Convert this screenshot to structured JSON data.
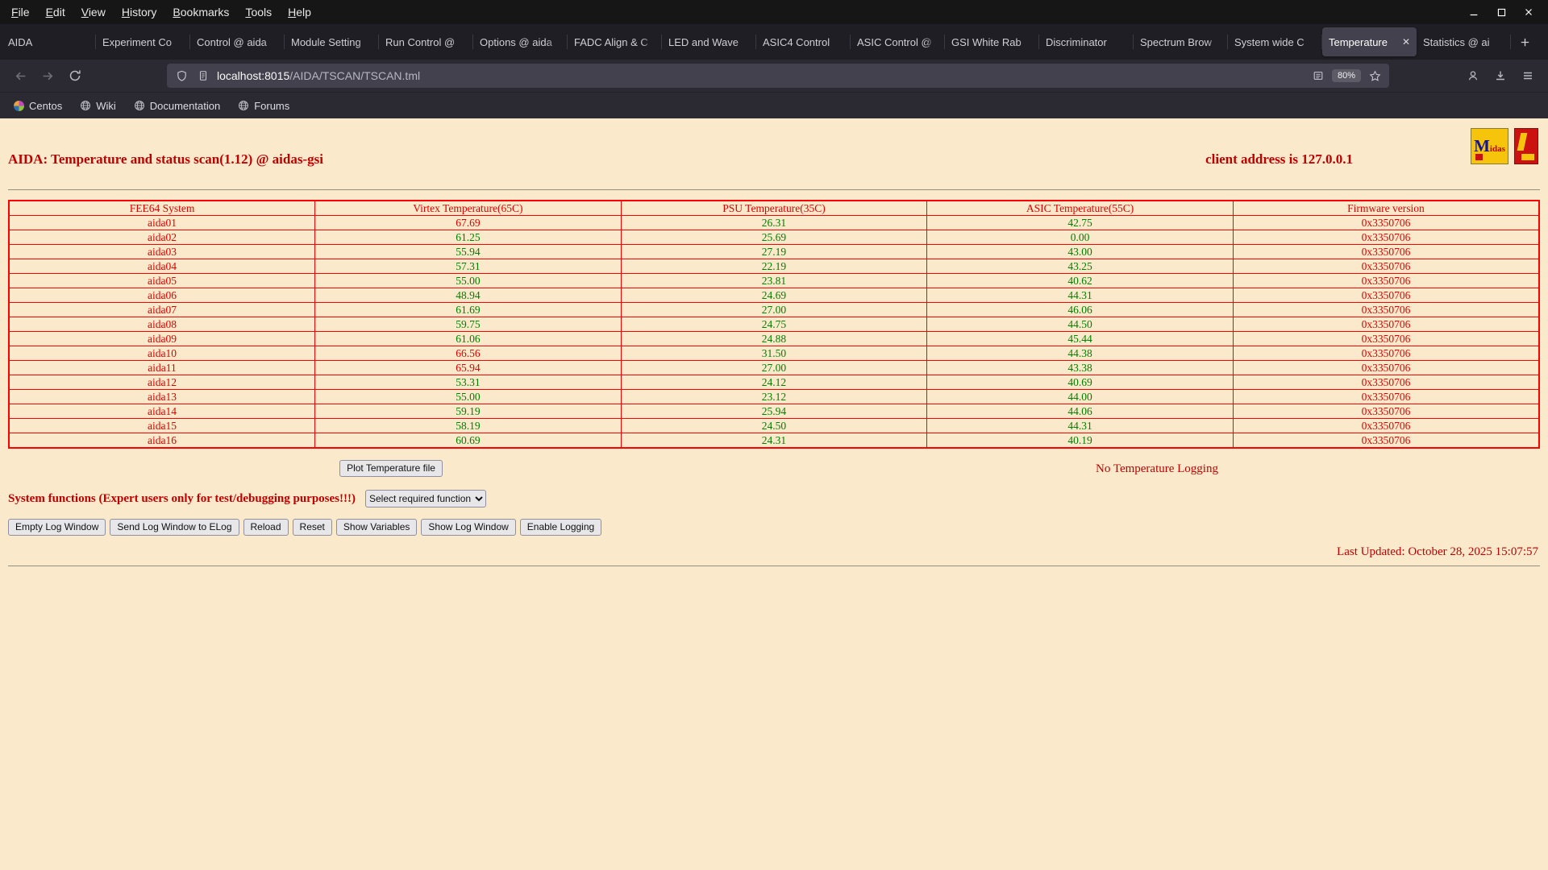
{
  "browser": {
    "menu_items": [
      "File",
      "Edit",
      "View",
      "History",
      "Bookmarks",
      "Tools",
      "Help"
    ],
    "tabs": [
      {
        "label": "AIDA"
      },
      {
        "label": "Experiment Co"
      },
      {
        "label": "Control @ aida"
      },
      {
        "label": "Module Setting"
      },
      {
        "label": "Run Control @"
      },
      {
        "label": "Options @ aida"
      },
      {
        "label": "FADC Align & C"
      },
      {
        "label": "LED and Wave"
      },
      {
        "label": "ASIC4 Control"
      },
      {
        "label": "ASIC Control @"
      },
      {
        "label": "GSI White Rab"
      },
      {
        "label": "Discriminator"
      },
      {
        "label": "Spectrum Brow"
      },
      {
        "label": "System wide C"
      },
      {
        "label": "Temperature",
        "active": true
      },
      {
        "label": "Statistics @ ai"
      }
    ],
    "url_host": "localhost:8015",
    "url_path": "/AIDA/TSCAN/TSCAN.tml",
    "zoom_level": "80%",
    "bookmarks": [
      {
        "label": "Centos",
        "icon": "centos"
      },
      {
        "label": "Wiki",
        "icon": "globe"
      },
      {
        "label": "Documentation",
        "icon": "globe"
      },
      {
        "label": "Forums",
        "icon": "globe"
      }
    ]
  },
  "page": {
    "title": "AIDA: Temperature and status scan(1.12) @ aidas-gsi",
    "client_address": "client address is 127.0.0.1",
    "midas_logo_text": "Midas",
    "table": {
      "headers": [
        "FEE64 System",
        "Virtex Temperature(65C)",
        "PSU Temperature(35C)",
        "ASIC Temperature(55C)",
        "Firmware version"
      ],
      "thresholds": {
        "virtex": 65,
        "psu": 35,
        "asic": 55
      },
      "rows": [
        {
          "name": "aida01",
          "virtex": "67.69",
          "psu": "26.31",
          "asic": "42.75",
          "firmware": "0x3350706"
        },
        {
          "name": "aida02",
          "virtex": "61.25",
          "psu": "25.69",
          "asic": "0.00",
          "firmware": "0x3350706"
        },
        {
          "name": "aida03",
          "virtex": "55.94",
          "psu": "27.19",
          "asic": "43.00",
          "firmware": "0x3350706"
        },
        {
          "name": "aida04",
          "virtex": "57.31",
          "psu": "22.19",
          "asic": "43.25",
          "firmware": "0x3350706"
        },
        {
          "name": "aida05",
          "virtex": "55.00",
          "psu": "23.81",
          "asic": "40.62",
          "firmware": "0x3350706"
        },
        {
          "name": "aida06",
          "virtex": "48.94",
          "psu": "24.69",
          "asic": "44.31",
          "firmware": "0x3350706"
        },
        {
          "name": "aida07",
          "virtex": "61.69",
          "psu": "27.00",
          "asic": "46.06",
          "firmware": "0x3350706"
        },
        {
          "name": "aida08",
          "virtex": "59.75",
          "psu": "24.75",
          "asic": "44.50",
          "firmware": "0x3350706"
        },
        {
          "name": "aida09",
          "virtex": "61.06",
          "psu": "24.88",
          "asic": "45.44",
          "firmware": "0x3350706"
        },
        {
          "name": "aida10",
          "virtex": "66.56",
          "psu": "31.50",
          "asic": "44.38",
          "firmware": "0x3350706"
        },
        {
          "name": "aida11",
          "virtex": "65.94",
          "psu": "27.00",
          "asic": "43.38",
          "firmware": "0x3350706"
        },
        {
          "name": "aida12",
          "virtex": "53.31",
          "psu": "24.12",
          "asic": "40.69",
          "firmware": "0x3350706"
        },
        {
          "name": "aida13",
          "virtex": "55.00",
          "psu": "23.12",
          "asic": "44.00",
          "firmware": "0x3350706"
        },
        {
          "name": "aida14",
          "virtex": "59.19",
          "psu": "25.94",
          "asic": "44.06",
          "firmware": "0x3350706"
        },
        {
          "name": "aida15",
          "virtex": "58.19",
          "psu": "24.50",
          "asic": "44.31",
          "firmware": "0x3350706"
        },
        {
          "name": "aida16",
          "virtex": "60.69",
          "psu": "24.31",
          "asic": "40.19",
          "firmware": "0x3350706"
        }
      ]
    },
    "plot_button_label": "Plot Temperature file",
    "logging_status": "No Temperature Logging",
    "system_functions_label": "System functions (Expert users only for test/debugging purposes!!!)",
    "function_select_value": "Select required function",
    "log_buttons": [
      "Empty Log Window",
      "Send Log Window to ELog",
      "Reload",
      "Reset",
      "Show Variables",
      "Show Log Window",
      "Enable Logging"
    ],
    "last_updated": "Last Updated: October 28, 2025 15:07:57"
  },
  "colors": {
    "page_background": "#fbe9cb",
    "heading_red": "#c00000",
    "table_red": "#e00000",
    "value_green": "#008000",
    "table_border": "#ff0000"
  }
}
